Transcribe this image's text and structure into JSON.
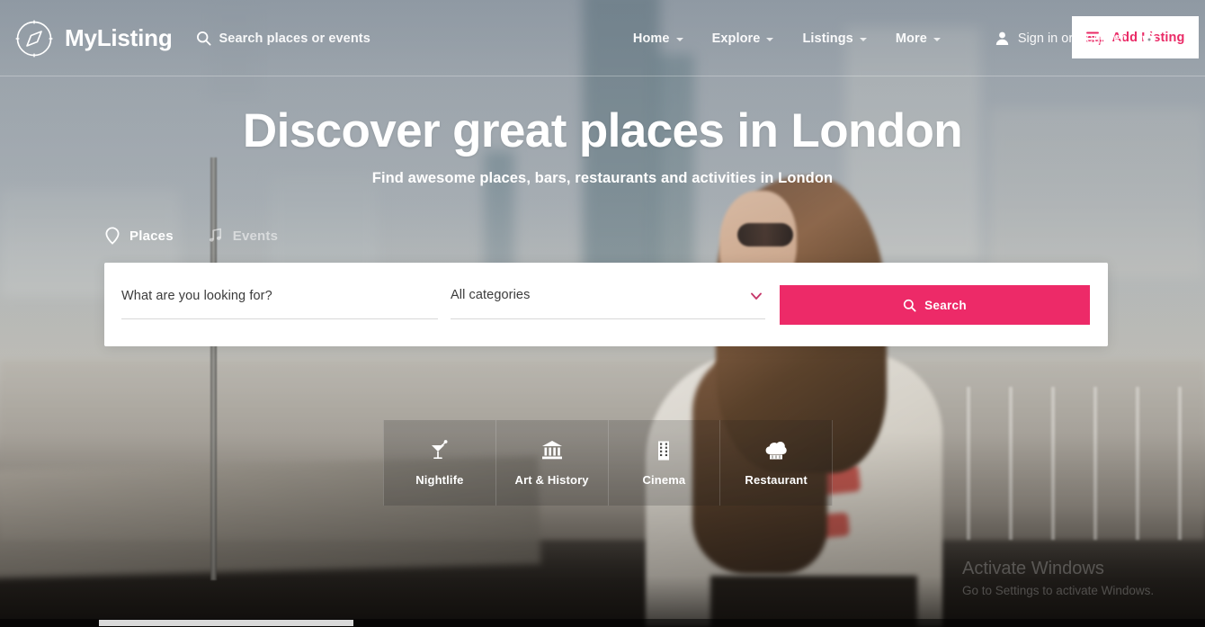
{
  "brand": {
    "name": "MyListing",
    "logo_icon": "compass-icon"
  },
  "header": {
    "search_prompt": "Search places or events",
    "search_icon": "search-icon",
    "nav": [
      {
        "label": "Home",
        "has_dropdown": true
      },
      {
        "label": "Explore",
        "has_dropdown": true
      },
      {
        "label": "Listings",
        "has_dropdown": true
      },
      {
        "label": "More",
        "has_dropdown": true
      }
    ],
    "account": {
      "label": "Sign in or Register",
      "icon": "user-icon"
    },
    "cart": {
      "icon": "basket-icon"
    },
    "add_listing": {
      "label": "Add Listing",
      "icon": "list-plus-icon",
      "text_color": "#ea2a66",
      "background": "#ffffff"
    }
  },
  "hero": {
    "title": "Discover great places in London",
    "subtitle": "Find awesome places, bars, restaurants and activities in London"
  },
  "tabs": [
    {
      "label": "Places",
      "icon": "map-pin-icon",
      "active": true
    },
    {
      "label": "Events",
      "icon": "music-note-icon",
      "active": false
    }
  ],
  "search_form": {
    "keyword": {
      "value": "",
      "placeholder": "What are you looking for?"
    },
    "category": {
      "selected": "All categories",
      "chevron_icon": "chevron-down-icon"
    },
    "submit": {
      "label": "Search",
      "icon": "search-icon",
      "background": "#ed2a68",
      "text_color": "#ffffff"
    }
  },
  "categories": [
    {
      "label": "Nightlife",
      "icon": "cocktail-icon"
    },
    {
      "label": "Art & History",
      "icon": "museum-icon"
    },
    {
      "label": "Cinema",
      "icon": "film-icon"
    },
    {
      "label": "Restaurant",
      "icon": "chef-hat-icon"
    }
  ],
  "watermark": {
    "title": "Activate Windows",
    "subtitle": "Go to Settings to activate Windows."
  },
  "theme": {
    "accent": "#ed2a68",
    "accent_dark": "#ea2a66",
    "header_text": "#ffffff"
  }
}
